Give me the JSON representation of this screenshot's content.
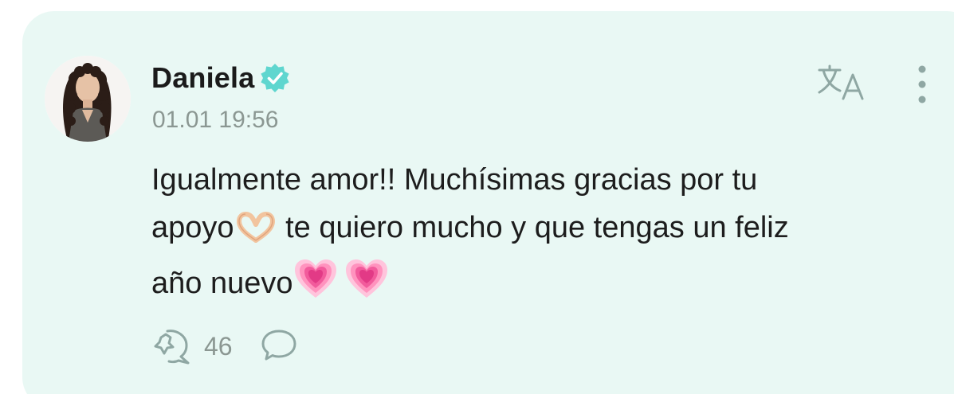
{
  "post": {
    "author": {
      "name": "Daniela",
      "verified": true,
      "avatar_icon": "avatar-photo"
    },
    "timestamp": "01.01 19:56",
    "text_line1": "Igualmente amor!! Muchísimas gracias por tu",
    "text_line2_a": "apoyo",
    "text_line2_b": " te quiero mucho y que tengas un feliz",
    "text_line3": "año nuevo",
    "emojis": [
      "heart-hands-emoji",
      "growing-heart-emoji",
      "growing-heart-emoji"
    ]
  },
  "actions": {
    "repost_icon": "repost-icon",
    "repost_count": "46",
    "comment_icon": "comment-icon"
  },
  "toolbar": {
    "translate_icon": "translate-icon",
    "more_icon": "more-vertical-icon"
  },
  "colors": {
    "card_background": "#e9f8f4",
    "text_primary": "#1d1d1d",
    "text_muted": "#8b9792",
    "verified_badge": "#5fd6cf"
  }
}
